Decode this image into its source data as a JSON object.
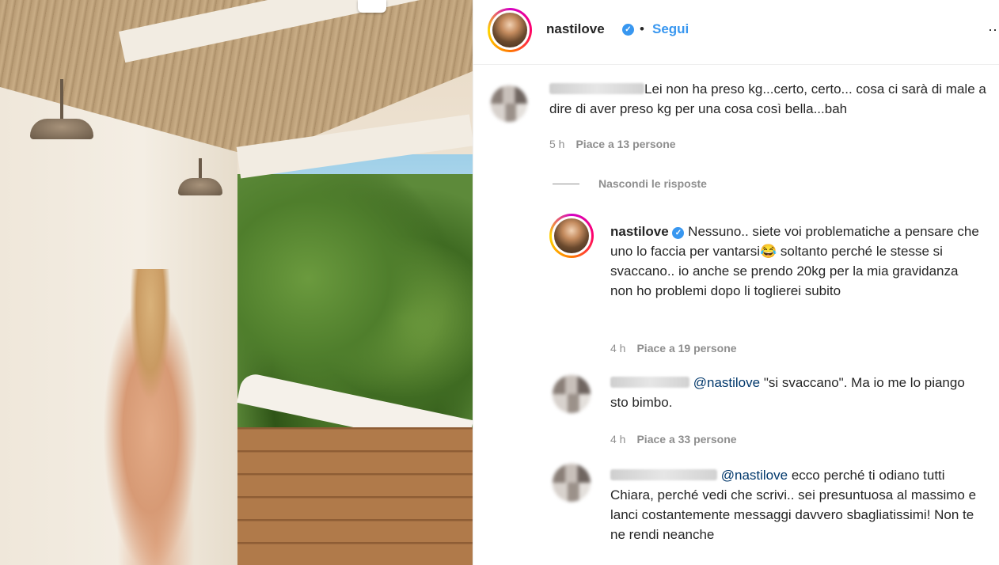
{
  "header": {
    "username": "nastilove",
    "verified_mark": "✓",
    "separator": "•",
    "follow_label": "Segui",
    "more_label": "⋯"
  },
  "comments": [
    {
      "text": "Lei non ha preso kg...certo, certo... cosa ci sarà di male a dire di aver preso kg per una cosa così bella...bah",
      "time": "5 h",
      "likes": "Piace a 13 persone"
    }
  ],
  "replies_toggle": "Nascondi le risposte",
  "replies": [
    {
      "username": "nastilove",
      "text": "Nessuno.. siete voi problematiche a pensare che uno lo faccia per vantarsi😂 soltanto perché le stesse si svaccano.. io anche se prendo 20kg per la mia gravidanza non ho problemi dopo li toglierei subito",
      "time": "4 h",
      "likes": "Piace a 19 persone"
    },
    {
      "mention": "@nastilove",
      "text": "\"si svaccano\". Ma io me lo piango sto bimbo.",
      "time": "4 h",
      "likes": "Piace a 33 persone"
    },
    {
      "mention": "@nastilove",
      "text": "ecco perché ti odiano tutti Chiara, perché vedi che scrivi.. sei presuntuosa al massimo e lanci costantemente messaggi davvero sbagliatissimi! Non te ne rendi neanche"
    }
  ],
  "icons": {
    "more": "more-options-icon",
    "verified": "verified-badge-icon"
  },
  "colors": {
    "follow_blue": "#3897f0",
    "verified_blue": "#3897f0",
    "meta_gray": "#8e8e8e",
    "mention_blue": "#00376b"
  }
}
